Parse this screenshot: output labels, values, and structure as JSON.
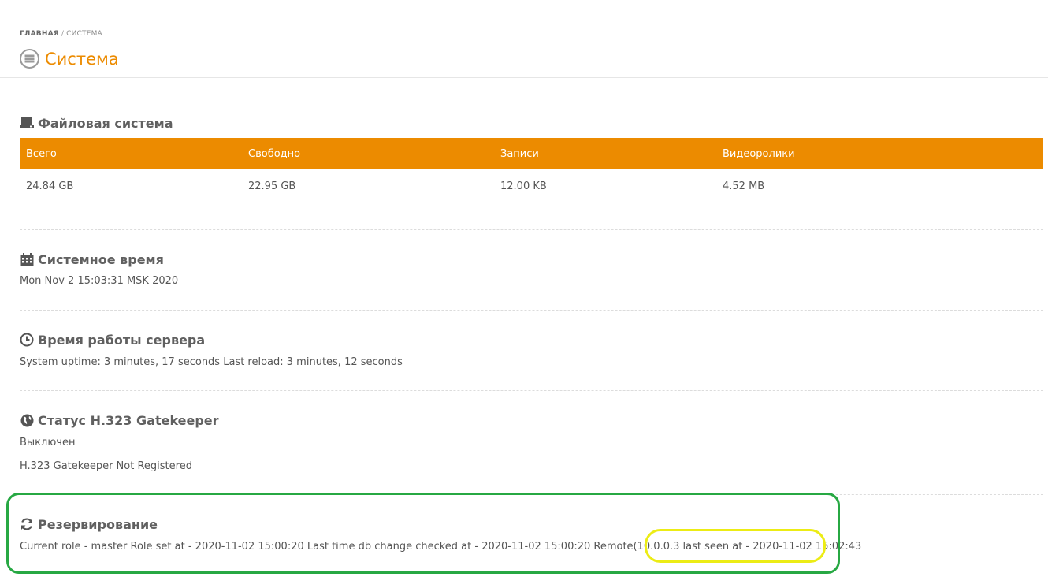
{
  "breadcrumb": {
    "home": "ГЛАВНАЯ",
    "separator": "/",
    "current": "СИСТЕМА"
  },
  "page": {
    "title": "Система",
    "icon": "server-icon"
  },
  "filesystem": {
    "title": "Файловая система",
    "icon": "hard-drive-icon",
    "columns": [
      "Всего",
      "Свободно",
      "Записи",
      "Видеоролики"
    ],
    "values": [
      "24.84 GB",
      "22.95 GB",
      "12.00 KB",
      "4.52 MB"
    ]
  },
  "system_time": {
    "title": "Системное время",
    "icon": "calendar-icon",
    "value": "Mon Nov 2 15:03:31 MSK 2020"
  },
  "uptime": {
    "title": "Время работы сервера",
    "icon": "clock-icon",
    "value": "System uptime: 3 minutes, 17 seconds Last reload: 3 minutes, 12 seconds"
  },
  "gatekeeper": {
    "title": "Статус H.323 Gatekeeper",
    "icon": "globe-icon",
    "status": "Выключен",
    "registration": "H.323 Gatekeeper Not Registered"
  },
  "redundancy": {
    "title": "Резервирование",
    "icon": "refresh-icon",
    "value": "Current role - master Role set at - 2020-11-02 15:00:20 Last time db change checked at - 2020-11-02 15:00:20 Remote(10.0.0.3 last seen at - 2020-11-02 15:02:43"
  },
  "colors": {
    "accent": "#ec8b00",
    "annotation_green": "#27a843",
    "annotation_yellow": "#ecec15"
  }
}
